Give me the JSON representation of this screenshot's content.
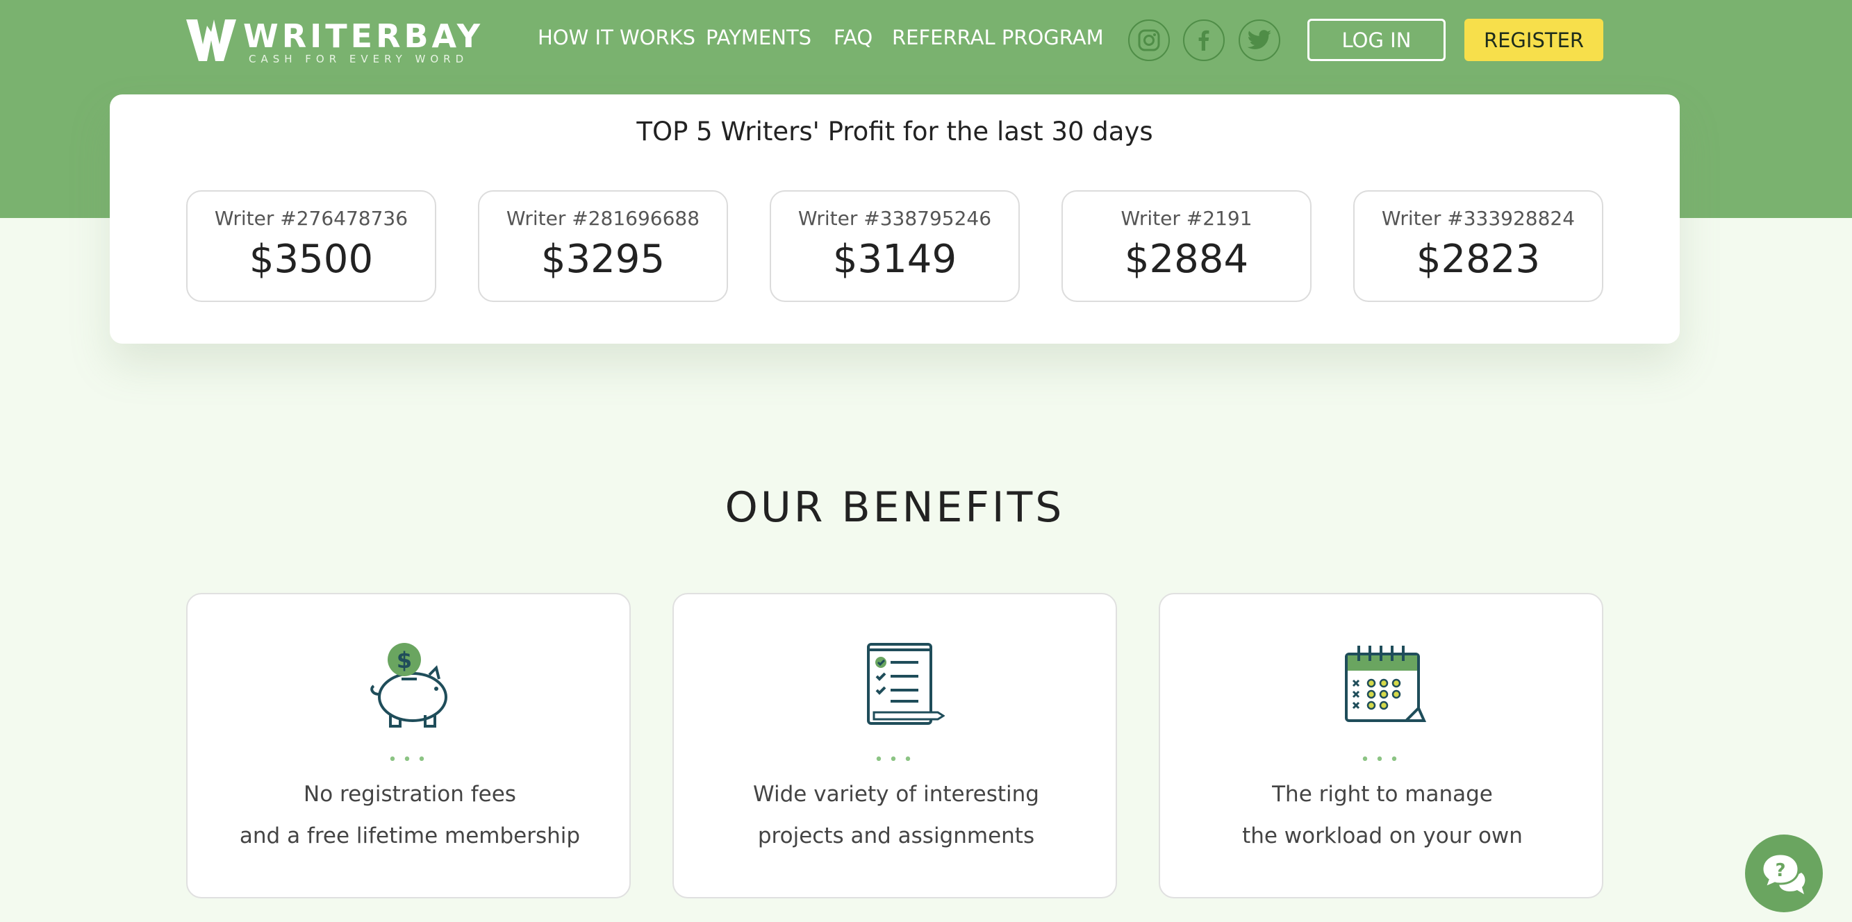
{
  "brand": {
    "name": "WRITERBAY",
    "tagline": "CASH FOR EVERY WORD"
  },
  "nav": {
    "items": [
      {
        "label": "HOW IT WORKS"
      },
      {
        "label": "PAYMENTS"
      },
      {
        "label": "FAQ"
      },
      {
        "label": "REFERRAL PROGRAM"
      }
    ]
  },
  "social": [
    "instagram-icon",
    "facebook-icon",
    "twitter-icon"
  ],
  "auth": {
    "login_label": "LOG IN",
    "register_label": "REGISTER"
  },
  "top_writers": {
    "title": "TOP 5 Writers' Profit for the last 30 days",
    "writers": [
      {
        "name": "Writer #276478736",
        "amount": "$3500"
      },
      {
        "name": "Writer #281696688",
        "amount": "$3295"
      },
      {
        "name": "Writer #338795246",
        "amount": "$3149"
      },
      {
        "name": "Writer #2191",
        "amount": "$2884"
      },
      {
        "name": "Writer #333928824",
        "amount": "$2823"
      }
    ]
  },
  "benefits": {
    "title": "OUR BENEFITS",
    "items": [
      {
        "icon": "piggy-bank-icon",
        "line1": "No registration fees",
        "line2": "and a free lifetime membership"
      },
      {
        "icon": "checklist-icon",
        "line1": "Wide variety of interesting",
        "line2": "projects and assignments"
      },
      {
        "icon": "calendar-icon",
        "line1": "The right to manage",
        "line2": "the workload on your own"
      }
    ]
  },
  "colors": {
    "header_green": "#7ab26f",
    "page_bg": "#f3faef",
    "register_yellow": "#f7df4b",
    "accent_green": "#6aa560"
  }
}
